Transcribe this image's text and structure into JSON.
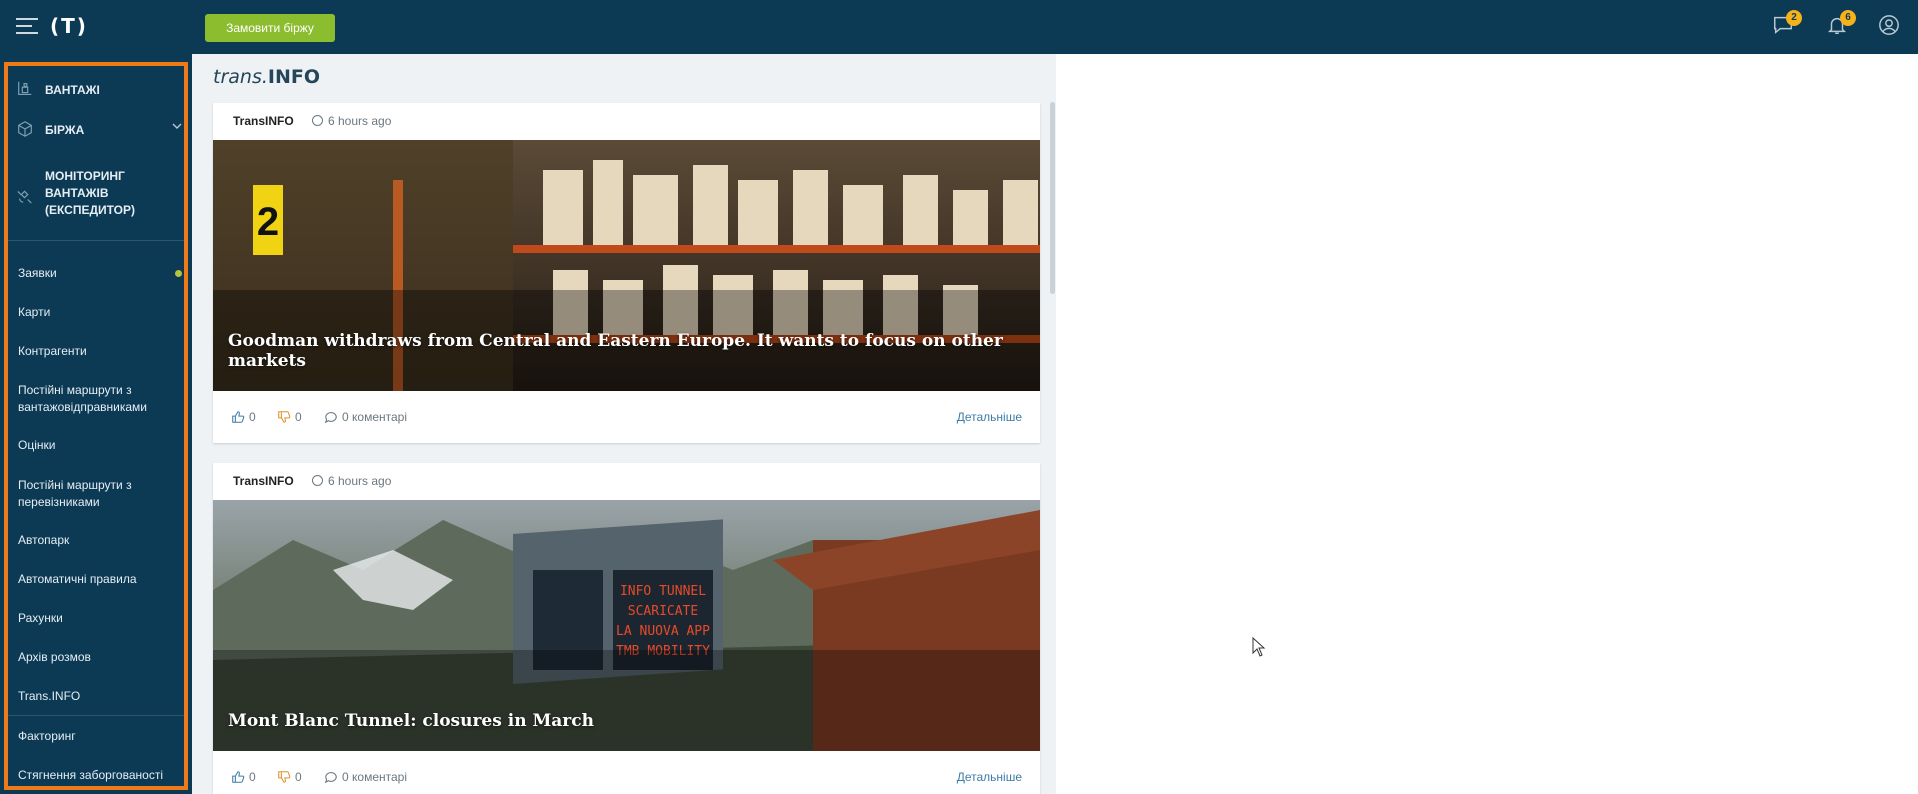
{
  "topbar": {
    "logo_text": "(T)",
    "order_button": "Замовити біржу",
    "messages_badge": "2",
    "notifications_badge": "6"
  },
  "sidebar": {
    "main_items": [
      {
        "label": "ВАНТАЖІ",
        "icon": "cargo-icon"
      },
      {
        "label": "БІРЖА",
        "icon": "box-icon"
      },
      {
        "label": "МОНІТОРИНГ ВАНТАЖІВ (ЕКСПЕДИТОР)",
        "icon": "satellite-icon"
      }
    ],
    "items": [
      "Заявки",
      "Карти",
      "Контрагенти",
      "Постійні маршрути з вантажовідправниками",
      "Оцінки",
      "Постійні маршрути з перевізниками",
      "Автопарк",
      "Автоматичні правила",
      "Рахунки",
      "Архів розмов",
      "Trans.INFO"
    ],
    "bottom_items": [
      "Факторинг",
      "Стягнення заборгованості"
    ]
  },
  "brand": {
    "prefix": "trans.",
    "suffix": "INFO"
  },
  "cards": [
    {
      "source": "TransINFO",
      "time": "6 hours ago",
      "title": "Goodman withdraws from Central and Eastern Europe. It wants to focus on other markets",
      "likes": "0",
      "dislikes": "0",
      "comments": "0 коментарі",
      "more": "Детальніше",
      "image_sign": "2"
    },
    {
      "source": "TransINFO",
      "time": "6 hours ago",
      "title": "Mont Blanc Tunnel: closures in March",
      "likes": "0",
      "dislikes": "0",
      "comments": "0 коментарі",
      "more": "Детальніше",
      "image_sign": [
        "INFO TUNNEL",
        "SCARICATE",
        "LA NUOVA APP",
        "TMB MOBILITY"
      ]
    }
  ],
  "colors": {
    "navy": "#0c3a55",
    "accent_green": "#8cbd2f",
    "badge_yellow": "#f5b21b",
    "highlight_orange": "#ef7a1a"
  }
}
